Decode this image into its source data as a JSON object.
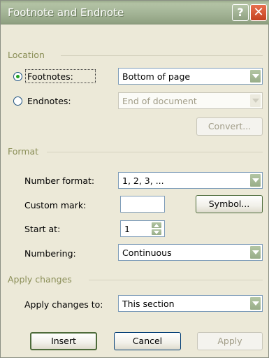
{
  "dialog": {
    "title": "Footnote and Endnote",
    "help_glyph": "?",
    "close_glyph": "✕"
  },
  "location": {
    "group_label": "Location",
    "footnotes_label": "Footnotes:",
    "footnotes_value": "Bottom of page",
    "footnotes_selected": true,
    "endnotes_label": "Endnotes:",
    "endnotes_value": "End of document",
    "endnotes_selected": false,
    "convert_label": "Convert..."
  },
  "format": {
    "group_label": "Format",
    "number_format_label": "Number format:",
    "number_format_value": "1, 2, 3, ...",
    "custom_mark_label": "Custom mark:",
    "custom_mark_value": "",
    "symbol_label": "Symbol...",
    "start_at_label": "Start at:",
    "start_at_value": "1",
    "numbering_label": "Numbering:",
    "numbering_value": "Continuous"
  },
  "apply": {
    "group_label": "Apply changes",
    "apply_to_label": "Apply changes to:",
    "apply_to_value": "This section"
  },
  "buttons": {
    "insert": "Insert",
    "cancel": "Cancel",
    "apply": "Apply"
  }
}
